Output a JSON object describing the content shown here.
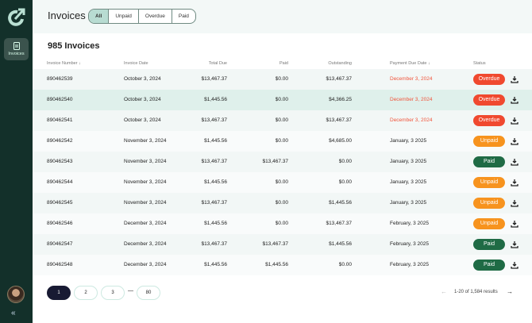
{
  "sidebar": {
    "nav_label": "Invoices"
  },
  "header": {
    "title": "Invoices",
    "filters": [
      "All",
      "Unpaid",
      "Overdue",
      "Paid"
    ]
  },
  "main": {
    "count": "985 Invoices",
    "columns": [
      "Invoice Number",
      "Invoice Date",
      "Total Due",
      "Paid",
      "Outstanding",
      "Payment Due Date",
      "Status"
    ],
    "rows": [
      {
        "num": "890462539",
        "date": "October 3, 2024",
        "total": "$13,467.37",
        "paid": "$0.00",
        "out": "$13,467.37",
        "due": "December 3, 2024",
        "status": "Overdue"
      },
      {
        "num": "890462540",
        "date": "October 3, 2024",
        "total": "$1,445.56",
        "paid": "$0.00",
        "out": "$4,366.25",
        "due": "December 3, 2024",
        "status": "Overdue"
      },
      {
        "num": "890462541",
        "date": "October 3, 2024",
        "total": "$13,467.37",
        "paid": "$0.00",
        "out": "$13,467.37",
        "due": "December 3, 2024",
        "status": "Overdue"
      },
      {
        "num": "890462542",
        "date": "November 3, 2024",
        "total": "$1,445.56",
        "paid": "$0.00",
        "out": "$4,685.00",
        "due": "January, 3 2025",
        "status": "Unpaid"
      },
      {
        "num": "890462543",
        "date": "November 3, 2024",
        "total": "$13,467.37",
        "paid": "$13,467.37",
        "out": "$0.00",
        "due": "January, 3 2025",
        "status": "Paid"
      },
      {
        "num": "890462544",
        "date": "November 3, 2024",
        "total": "$1,445.56",
        "paid": "$0.00",
        "out": "$0.00",
        "due": "January, 3 2025",
        "status": "Unpaid"
      },
      {
        "num": "890462545",
        "date": "November 3, 2024",
        "total": "$13,467.37",
        "paid": "$0.00",
        "out": "$1,445.56",
        "due": "January, 3 2025",
        "status": "Unpaid"
      },
      {
        "num": "890462546",
        "date": "December 3, 2024",
        "total": "$1,445.56",
        "paid": "$0.00",
        "out": "$13,467.37",
        "due": "February, 3 2025",
        "status": "Unpaid"
      },
      {
        "num": "890462547",
        "date": "December 3, 2024",
        "total": "$13,467.37",
        "paid": "$13,467.37",
        "out": "$1,445.56",
        "due": "February, 3 2025",
        "status": "Paid"
      },
      {
        "num": "890462548",
        "date": "December 3, 2024",
        "total": "$1,445.56",
        "paid": "$1,445.56",
        "out": "$0.00",
        "due": "February, 3 2025",
        "status": "Paid"
      }
    ]
  },
  "pagination": {
    "pages": [
      "1",
      "2",
      "3",
      "80"
    ],
    "ellipsis": "—",
    "results": "1-20 of 1,584 results"
  },
  "colors": {
    "Overdue": "#f0492f",
    "Unpaid": "#f7931e",
    "Paid": "#1f6b45",
    "overdue_text": "#f0553c"
  }
}
